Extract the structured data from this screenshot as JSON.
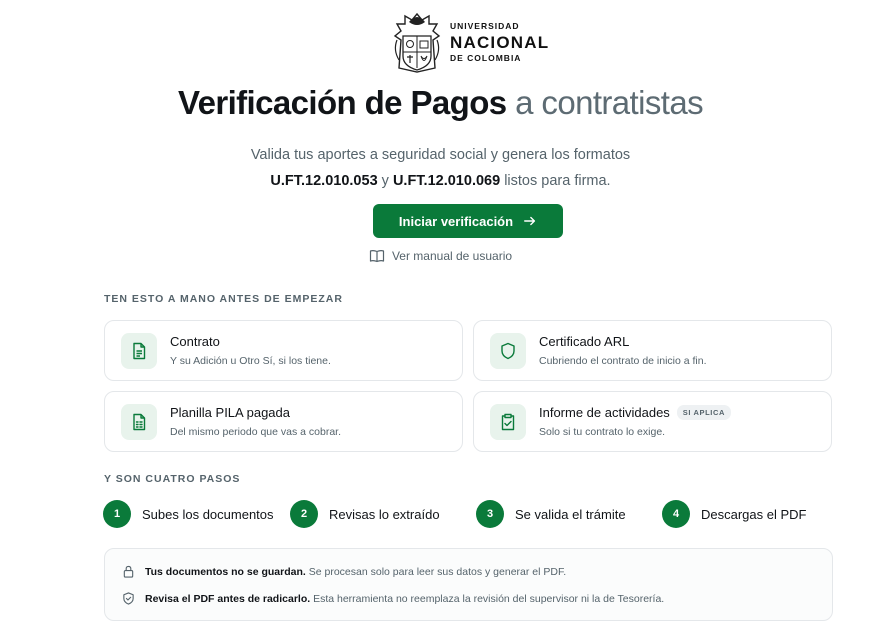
{
  "brand": {
    "line1": "UNIVERSIDAD",
    "line2": "NACIONAL",
    "line3": "DE COLOMBIA",
    "primary_color": "#0a7a3a"
  },
  "hero": {
    "title_strong": "Verificación de Pagos",
    "title_light": " a contratistas",
    "subtitle_line1": "Valida tus aportes a seguridad social y genera los formatos",
    "format1": "U.FT.12.010.053",
    "connector": " y ",
    "format2": "U.FT.12.010.069",
    "subtitle_end": " listos para firma."
  },
  "cta": {
    "label": "Iniciar verificación",
    "icon": "arrow-right-icon"
  },
  "manual_link": {
    "label": "Ver manual de usuario",
    "icon": "book-icon"
  },
  "requirements": {
    "heading": "TEN ESTO A MANO ANTES DE EMPEZAR",
    "items": [
      {
        "title": "Contrato",
        "desc": "Y su Adición u Otro Sí, si los tiene.",
        "icon": "document-icon"
      },
      {
        "title": "Certificado ARL",
        "desc": "Cubriendo el contrato de inicio a fin.",
        "icon": "shield-icon"
      },
      {
        "title": "Planilla PILA pagada",
        "desc": "Del mismo periodo que vas a cobrar.",
        "icon": "spreadsheet-icon"
      },
      {
        "title": "Informe de actividades",
        "badge": "SI APLICA",
        "desc": "Solo si tu contrato lo exige.",
        "icon": "clipboard-check-icon"
      }
    ]
  },
  "steps": {
    "heading": "Y SON CUATRO PASOS",
    "items": [
      {
        "num": "1",
        "label": "Subes los documentos"
      },
      {
        "num": "2",
        "label": "Revisas lo extraído"
      },
      {
        "num": "3",
        "label": "Se valida el trámite"
      },
      {
        "num": "4",
        "label": "Descargas el PDF"
      }
    ]
  },
  "notices": [
    {
      "strong": "Tus documentos no se guardan.",
      "text": " Se procesan solo para leer sus datos y generar el PDF.",
      "icon": "lock-icon"
    },
    {
      "strong": "Revisa el PDF antes de radicarlo.",
      "text": " Esta herramienta no reemplaza la revisión del supervisor ni la de Tesorería.",
      "icon": "shield-check-icon"
    }
  ]
}
